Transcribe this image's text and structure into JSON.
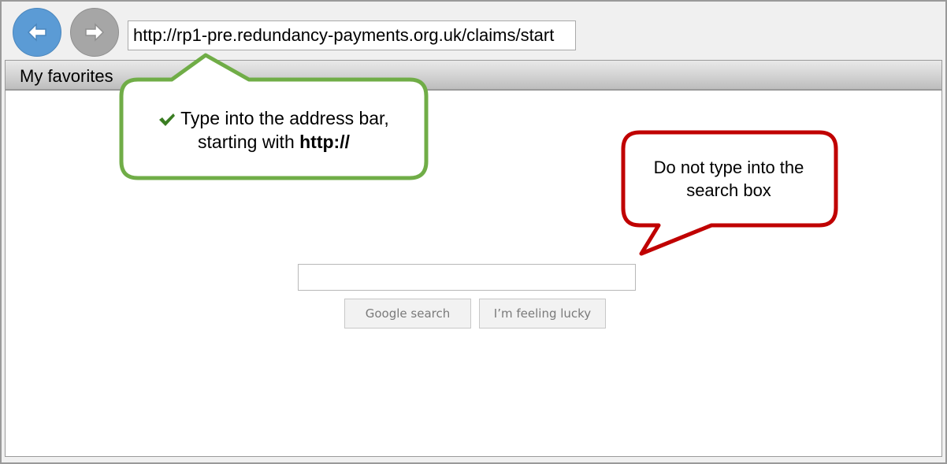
{
  "browser": {
    "address_bar": {
      "url": "http://rp1-pre.redundancy-payments.org.uk/claims/start"
    },
    "favorites_label": "My favorites",
    "back_icon": "arrow-left-icon",
    "forward_icon": "arrow-right-icon"
  },
  "page": {
    "search_input": {
      "value": ""
    },
    "google_search_label": "Google search",
    "lucky_label": "I’m feeling lucky"
  },
  "callouts": {
    "address_tip": {
      "line1": "Type into the address bar,",
      "line2_prefix": "starting with ",
      "line2_bold": "http://",
      "icon": "checkmark-icon",
      "border_color": "#70ad47"
    },
    "search_warning": {
      "line1": "Do not type into the",
      "line2": "search box",
      "border_color": "#c00000"
    }
  },
  "colors": {
    "back_button": "#5b9bd5",
    "forward_button": "#a6a6a6",
    "check": "#3a7d22"
  }
}
